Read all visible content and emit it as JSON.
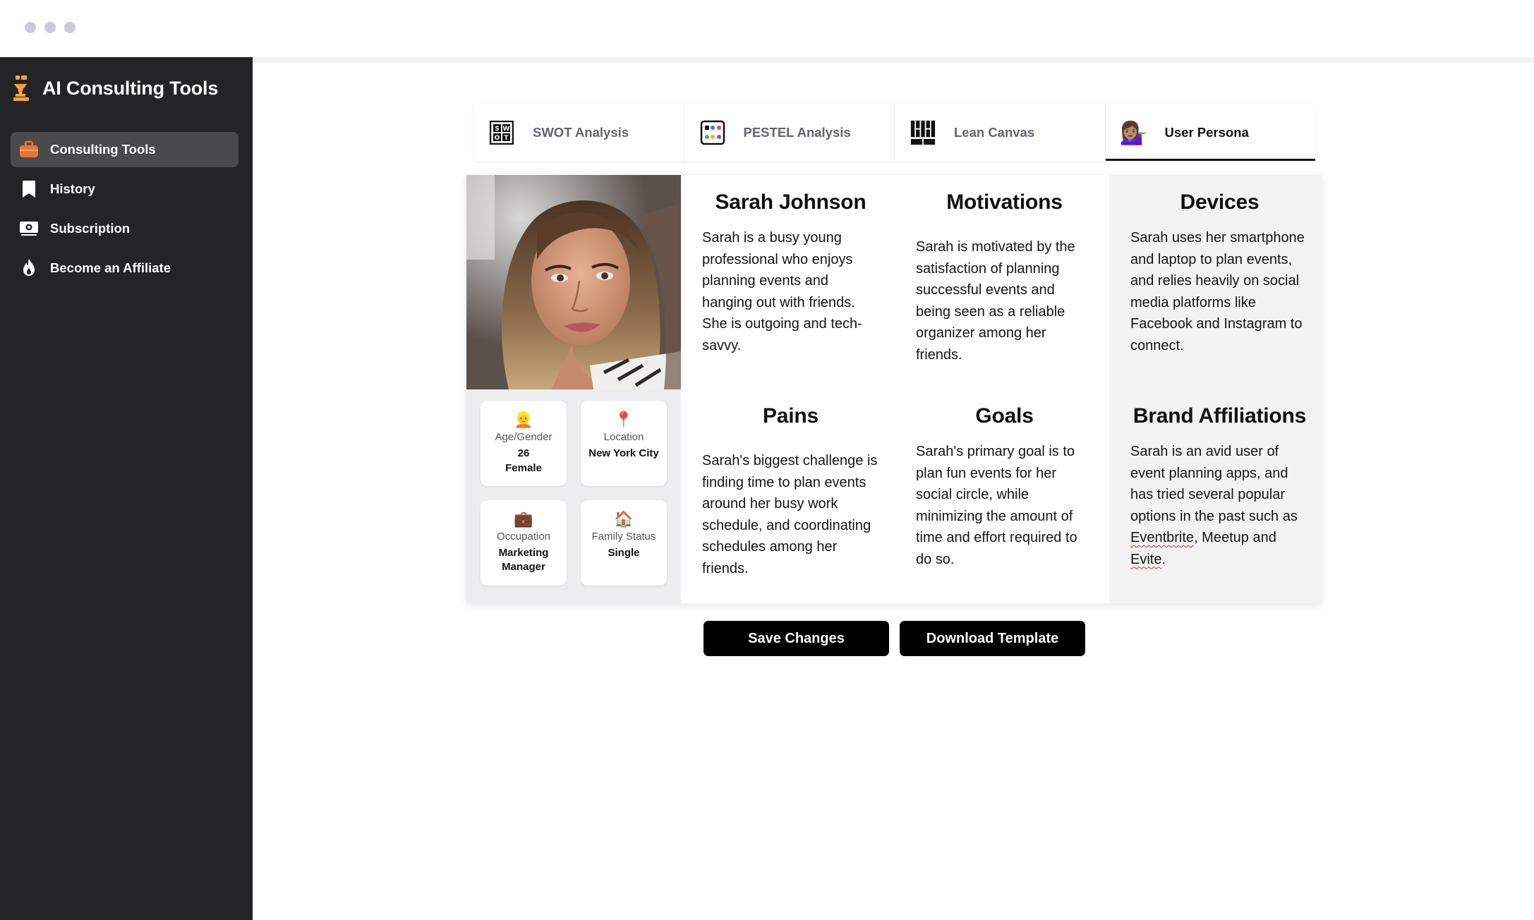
{
  "window": {
    "traffic_lights": [
      "close",
      "minimize",
      "zoom"
    ]
  },
  "sidebar": {
    "app_title": "AI Consulting Tools",
    "items": [
      {
        "label": "Consulting Tools",
        "icon": "briefcase-icon",
        "active": true
      },
      {
        "label": "History",
        "icon": "bookmark-icon",
        "active": false
      },
      {
        "label": "Subscription",
        "icon": "money-icon",
        "active": false
      },
      {
        "label": "Become an Affiliate",
        "icon": "flame-icon",
        "active": false
      }
    ]
  },
  "tabs": [
    {
      "label": "SWOT Analysis",
      "icon": "swot-icon",
      "active": false
    },
    {
      "label": "PESTEL Analysis",
      "icon": "pestel-icon",
      "active": false
    },
    {
      "label": "Lean Canvas",
      "icon": "lean-canvas-icon",
      "active": false
    },
    {
      "label": "User Persona",
      "icon": "woman-tipping-hand-icon",
      "active": true
    }
  ],
  "persona": {
    "name": "Sarah Johnson",
    "bio": "Sarah is a busy young professional who enjoys planning events and hanging out with friends. She is outgoing and tech-savvy.",
    "attributes": {
      "age_gender": {
        "emoji": "👱",
        "label": "Age/Gender",
        "value_line1": "26",
        "value_line2": "Female"
      },
      "location": {
        "emoji": "📍",
        "label": "Location",
        "value": "New York City"
      },
      "occupation": {
        "emoji": "💼",
        "label": "Occupation",
        "value": "Marketing Manager"
      },
      "family_status": {
        "emoji": "🏠",
        "label": "Family Status",
        "value": "Single"
      }
    },
    "motivations": {
      "title": "Motivations",
      "text": "Sarah is motivated by the satisfaction of planning successful events and being seen as a reliable organizer among her friends."
    },
    "devices": {
      "title": "Devices",
      "text": "Sarah uses her smartphone and laptop to plan events, and relies heavily on social media platforms like Facebook and Instagram to connect."
    },
    "pains": {
      "title": "Pains",
      "text": "Sarah's biggest challenge is finding time to plan events around her busy work schedule, and coordinating schedules among her friends."
    },
    "goals": {
      "title": "Goals",
      "text": "Sarah's primary goal is to plan fun events for her social circle, while minimizing the amount of time and effort required to do so."
    },
    "brand_affiliations": {
      "title": "Brand Affiliations",
      "text_before": "Sarah is an avid user of event planning apps, and has tried several popular options in the past such as ",
      "brand1": "Eventbrite",
      "text_mid": ", Meetup and ",
      "brand2": "Evite",
      "text_after": "."
    }
  },
  "actions": {
    "save_label": "Save Changes",
    "download_label": "Download Template"
  },
  "colors": {
    "sidebar_bg": "#242426",
    "sidebar_active": "#4a4a4c",
    "brand_accent": "#f0a340",
    "button_bg": "#000000",
    "highlight_column_bg": "#f3f3f4"
  }
}
